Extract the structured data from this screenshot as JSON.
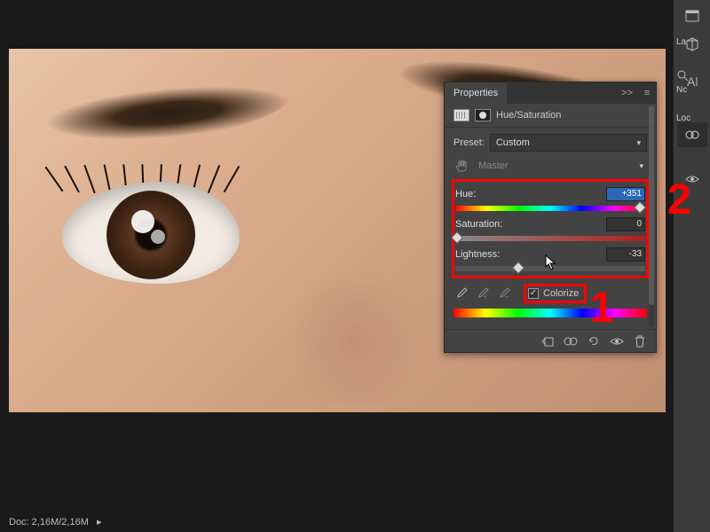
{
  "panel": {
    "title": "Properties",
    "adjustment_label": "Hue/Saturation",
    "preset_label": "Preset:",
    "preset_value": "Custom",
    "channel_value": "Master",
    "hue": {
      "label": "Hue:",
      "value": "+351",
      "percent": 97
    },
    "saturation": {
      "label": "Saturation:",
      "value": "0",
      "percent": 1
    },
    "lightness": {
      "label": "Lightness:",
      "value": "-33",
      "percent": 33
    },
    "colorize_label": "Colorize",
    "colorize_checked": true,
    "footer_icons": [
      "clip-icon",
      "mask-view-icon",
      "reset-icon",
      "visibility-icon",
      "trash-icon"
    ]
  },
  "right_labels": {
    "l1": "La",
    "l2": "Nc",
    "l3": "Loc"
  },
  "status": {
    "doc_label": "Doc: 2,16M/2,16M"
  },
  "annotations": {
    "one": "1",
    "two": "2"
  }
}
